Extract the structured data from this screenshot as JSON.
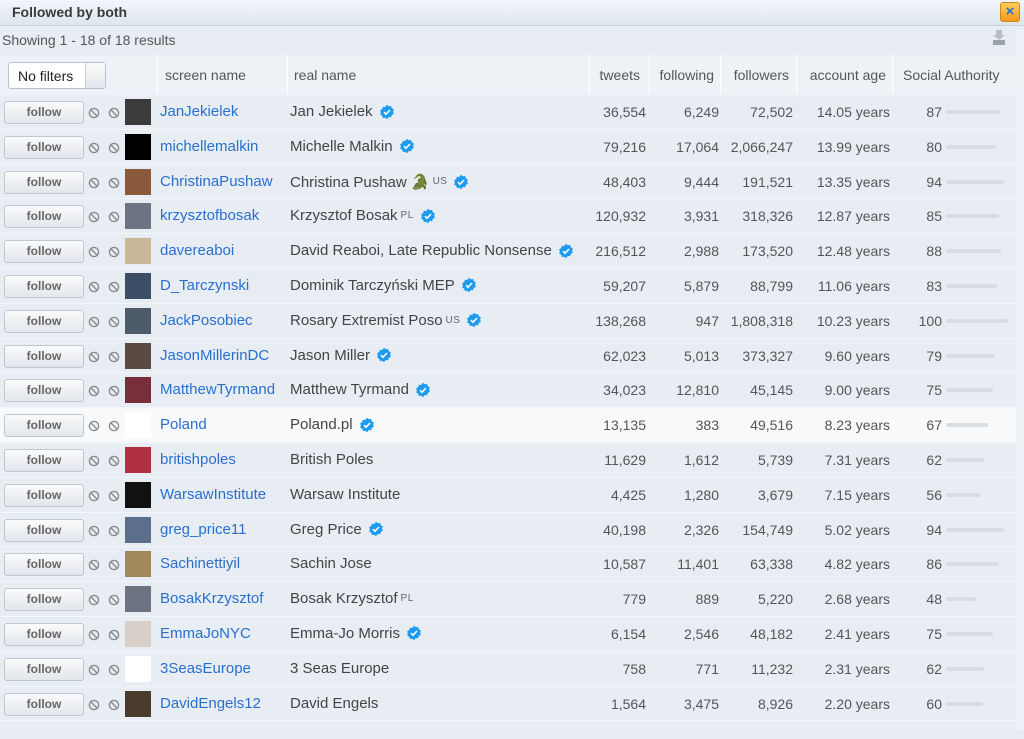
{
  "window": {
    "title": "Followed by both",
    "close_label": "×"
  },
  "results_info": "Showing 1 - 18 of 18 results",
  "filter": {
    "selected": "No filters"
  },
  "columns": {
    "screen_name": "screen name",
    "real_name": "real name",
    "tweets": "tweets",
    "following": "following",
    "followers": "followers",
    "account_age": "account age",
    "social_authority": "Social Authority"
  },
  "follow_label": "follow",
  "colors": {
    "link": "#2a6fcf",
    "verified": "#1d9bf0",
    "close_btn": "#f39a1c"
  },
  "rows": [
    {
      "screen_name": "JanJekielek",
      "real_name": "Jan Jekielek",
      "country": "",
      "verified": true,
      "tweets": "36,554",
      "following": "6,249",
      "followers": "72,502",
      "age": "14.05 years",
      "sa": 87,
      "avatar": "#3b3b3b"
    },
    {
      "screen_name": "michellemalkin",
      "real_name": "Michelle Malkin",
      "country": "",
      "verified": true,
      "tweets": "79,216",
      "following": "17,064",
      "followers": "2,066,247",
      "age": "13.99 years",
      "sa": 80,
      "avatar": "#000000"
    },
    {
      "screen_name": "ChristinaPushaw",
      "real_name": "Christina Pushaw 🐊",
      "country": "US",
      "verified": true,
      "tweets": "48,403",
      "following": "9,444",
      "followers": "191,521",
      "age": "13.35 years",
      "sa": 94,
      "avatar": "#8a5a3c"
    },
    {
      "screen_name": "krzysztofbosak",
      "real_name": "Krzysztof Bosak",
      "country": "PL",
      "verified": true,
      "tweets": "120,932",
      "following": "3,931",
      "followers": "318,326",
      "age": "12.87 years",
      "sa": 85,
      "avatar": "#6b7480"
    },
    {
      "screen_name": "davereaboi",
      "real_name": "David Reaboi, Late Republic Nonsense",
      "country": "",
      "verified": true,
      "tweets": "216,512",
      "following": "2,988",
      "followers": "173,520",
      "age": "12.48 years",
      "sa": 88,
      "avatar": "#c9b89a"
    },
    {
      "screen_name": "D_Tarczynski",
      "real_name": "Dominik Tarczyński MEP",
      "country": "",
      "verified": true,
      "tweets": "59,207",
      "following": "5,879",
      "followers": "88,799",
      "age": "11.06 years",
      "sa": 83,
      "avatar": "#3c4e66"
    },
    {
      "screen_name": "JackPosobiec",
      "real_name": "Rosary Extremist Poso",
      "country": "US",
      "verified": true,
      "tweets": "138,268",
      "following": "947",
      "followers": "1,808,318",
      "age": "10.23 years",
      "sa": 100,
      "avatar": "#4c5a6a"
    },
    {
      "screen_name": "JasonMillerinDC",
      "real_name": "Jason Miller",
      "country": "",
      "verified": true,
      "tweets": "62,023",
      "following": "5,013",
      "followers": "373,327",
      "age": "9.60 years",
      "sa": 79,
      "avatar": "#5a4a42"
    },
    {
      "screen_name": "MatthewTyrmand",
      "real_name": "Matthew Tyrmand",
      "country": "",
      "verified": true,
      "tweets": "34,023",
      "following": "12,810",
      "followers": "45,145",
      "age": "9.00 years",
      "sa": 75,
      "avatar": "#7a2e3a"
    },
    {
      "screen_name": "Poland",
      "real_name": "Poland.pl",
      "country": "",
      "verified": true,
      "tweets": "13,135",
      "following": "383",
      "followers": "49,516",
      "age": "8.23 years",
      "sa": 67,
      "avatar": "#ffffff"
    },
    {
      "screen_name": "britishpoles",
      "real_name": "British Poles",
      "country": "",
      "verified": false,
      "tweets": "11,629",
      "following": "1,612",
      "followers": "5,739",
      "age": "7.31 years",
      "sa": 62,
      "avatar": "#b03040"
    },
    {
      "screen_name": "WarsawInstitute",
      "real_name": "Warsaw Institute",
      "country": "",
      "verified": false,
      "tweets": "4,425",
      "following": "1,280",
      "followers": "3,679",
      "age": "7.15 years",
      "sa": 56,
      "avatar": "#111111"
    },
    {
      "screen_name": "greg_price11",
      "real_name": "Greg Price",
      "country": "",
      "verified": true,
      "tweets": "40,198",
      "following": "2,326",
      "followers": "154,749",
      "age": "5.02 years",
      "sa": 94,
      "avatar": "#5b6f8a"
    },
    {
      "screen_name": "Sachinettiyil",
      "real_name": "Sachin Jose",
      "country": "",
      "verified": false,
      "tweets": "10,587",
      "following": "11,401",
      "followers": "63,338",
      "age": "4.82 years",
      "sa": 86,
      "avatar": "#a08a5a"
    },
    {
      "screen_name": "BosakKrzysztof",
      "real_name": "Bosak Krzysztof",
      "country": "PL",
      "verified": false,
      "tweets": "779",
      "following": "889",
      "followers": "5,220",
      "age": "2.68 years",
      "sa": 48,
      "avatar": "#6b7480"
    },
    {
      "screen_name": "EmmaJoNYC",
      "real_name": "Emma-Jo Morris",
      "country": "",
      "verified": true,
      "tweets": "6,154",
      "following": "2,546",
      "followers": "48,182",
      "age": "2.41 years",
      "sa": 75,
      "avatar": "#d8d0c8"
    },
    {
      "screen_name": "3SeasEurope",
      "real_name": "3 Seas Europe",
      "country": "",
      "verified": false,
      "tweets": "758",
      "following": "771",
      "followers": "11,232",
      "age": "2.31 years",
      "sa": 62,
      "avatar": "#ffffff"
    },
    {
      "screen_name": "DavidEngels12",
      "real_name": "David Engels",
      "country": "",
      "verified": false,
      "tweets": "1,564",
      "following": "3,475",
      "followers": "8,926",
      "age": "2.20 years",
      "sa": 60,
      "avatar": "#4a3c2c"
    }
  ]
}
